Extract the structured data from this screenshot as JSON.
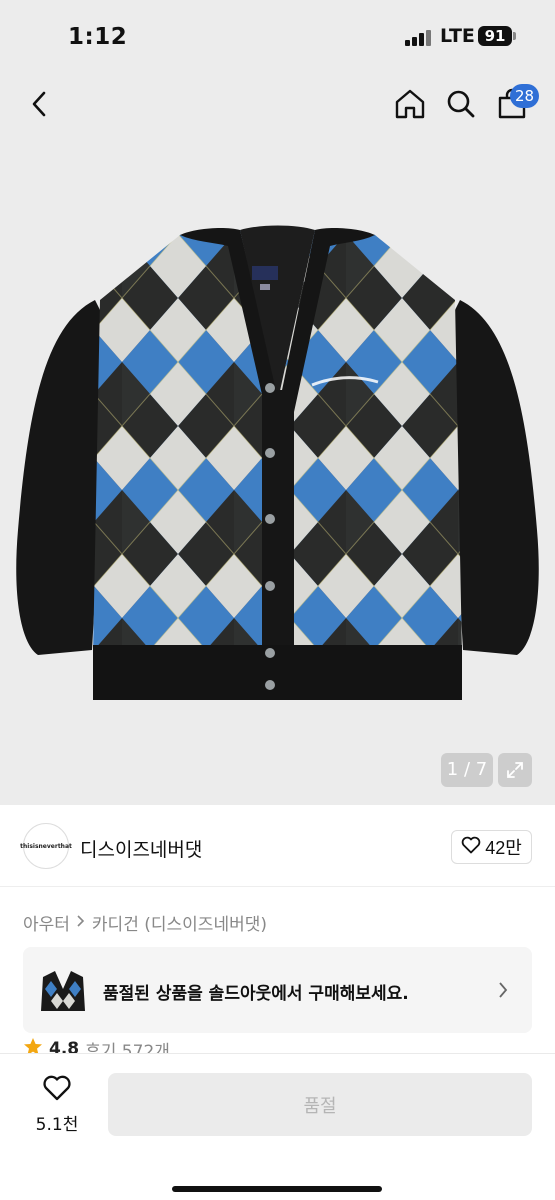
{
  "status": {
    "time": "1:12",
    "network": "LTE",
    "battery": "91"
  },
  "nav": {
    "cart_count": "28"
  },
  "gallery": {
    "counter": "1 / 7"
  },
  "brand": {
    "logo_text": "thisisneverthat",
    "name": "디스이즈네버댓",
    "likes": "42만"
  },
  "breadcrumb": {
    "parent": "아우터",
    "current": "카디건 (디스이즈네버댓)"
  },
  "promo": {
    "text": "품절된 상품을 솔드아웃에서 구매해보세요."
  },
  "rating": {
    "score": "4.8",
    "reviews": "후기 572개"
  },
  "bottom": {
    "wish_count": "5.1천",
    "buy_label": "품절"
  },
  "colors": {
    "accent": "#2f6fd6",
    "argyle_blue": "#3f7fc4",
    "argyle_light": "#d8d8d4",
    "knit_black": "#161616"
  },
  "icons": [
    "back-icon",
    "home-icon",
    "search-icon",
    "cart-icon",
    "expand-icon",
    "heart-icon",
    "chevron-right-icon",
    "star-icon"
  ]
}
